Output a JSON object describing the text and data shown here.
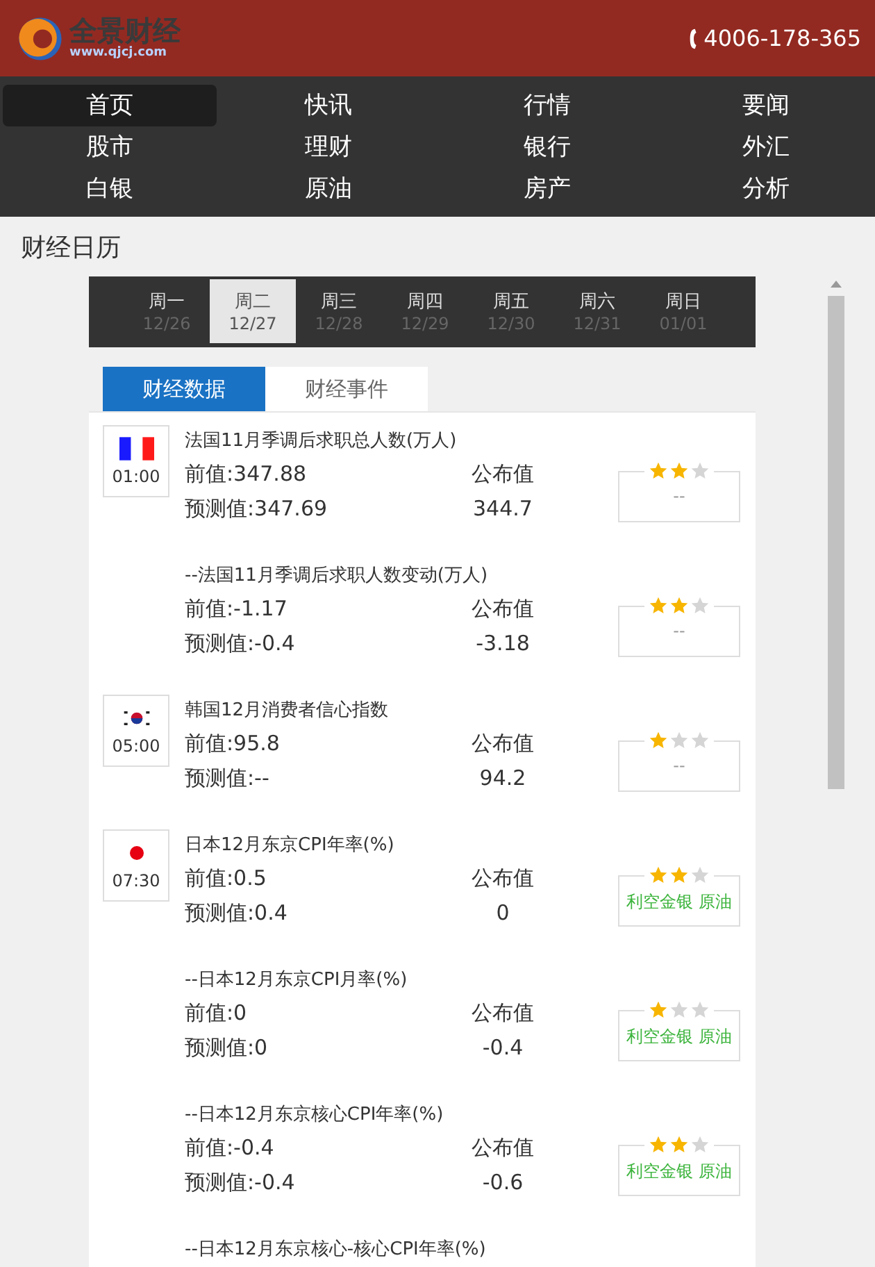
{
  "header": {
    "logo_text": "全景财经",
    "logo_url": "www.qjcj.com",
    "phone": "4006-178-365"
  },
  "nav": [
    {
      "label": "首页",
      "selected": true
    },
    {
      "label": "快讯",
      "selected": false
    },
    {
      "label": "行情",
      "selected": false
    },
    {
      "label": "要闻",
      "selected": false
    },
    {
      "label": "股市",
      "selected": false
    },
    {
      "label": "理财",
      "selected": false
    },
    {
      "label": "银行",
      "selected": false
    },
    {
      "label": "外汇",
      "selected": false
    },
    {
      "label": "白银",
      "selected": false
    },
    {
      "label": "原油",
      "selected": false
    },
    {
      "label": "房产",
      "selected": false
    },
    {
      "label": "分析",
      "selected": false
    }
  ],
  "section_title": "财经日历",
  "days": [
    {
      "weekday": "周一",
      "date": "12/26",
      "selected": false
    },
    {
      "weekday": "周二",
      "date": "12/27",
      "selected": true
    },
    {
      "weekday": "周三",
      "date": "12/28",
      "selected": false
    },
    {
      "weekday": "周四",
      "date": "12/29",
      "selected": false
    },
    {
      "weekday": "周五",
      "date": "12/30",
      "selected": false
    },
    {
      "weekday": "周六",
      "date": "12/31",
      "selected": false
    },
    {
      "weekday": "周日",
      "date": "01/01",
      "selected": false
    }
  ],
  "tabs": [
    {
      "label": "财经数据",
      "selected": true
    },
    {
      "label": "财经事件",
      "selected": false
    }
  ],
  "events": [
    {
      "kind": "france",
      "time": "01:00",
      "items": [
        {
          "title": "法国11月季调后求职总人数(万人)",
          "previous": "前值:347.88",
          "forecast": "预测值:347.69",
          "actual_label": "公布值",
          "actual": "344.7",
          "stars": 2,
          "impact": "--"
        },
        {
          "title": "--法国11月季调后求职人数变动(万人)",
          "previous": "前值:-1.17",
          "forecast": "预测值:-0.4",
          "actual_label": "公布值",
          "actual": "-3.18",
          "stars": 2,
          "impact": "--"
        }
      ]
    },
    {
      "kind": "korea",
      "time": "05:00",
      "items": [
        {
          "title": "韩国12月消费者信心指数",
          "previous": "前值:95.8",
          "forecast": "预测值:--",
          "actual_label": "公布值",
          "actual": "94.2",
          "stars": 1,
          "impact": "--"
        }
      ]
    },
    {
      "kind": "japan",
      "time": "07:30",
      "items": [
        {
          "title": "日本12月东京CPI年率(%)",
          "previous": "前值:0.5",
          "forecast": "预测值:0.4",
          "actual_label": "公布值",
          "actual": "0",
          "stars": 2,
          "impact": "利空金银 原油"
        },
        {
          "title": "--日本12月东京CPI月率(%)",
          "previous": "前值:0",
          "forecast": "预测值:0",
          "actual_label": "公布值",
          "actual": "-0.4",
          "stars": 1,
          "impact": "利空金银 原油"
        },
        {
          "title": "--日本12月东京核心CPI年率(%)",
          "previous": "前值:-0.4",
          "forecast": "预测值:-0.4",
          "actual_label": "公布值",
          "actual": "-0.6",
          "stars": 2,
          "impact": "利空金银 原油"
        },
        {
          "title": "--日本12月东京核心-核心CPI年率(%)"
        }
      ]
    }
  ]
}
